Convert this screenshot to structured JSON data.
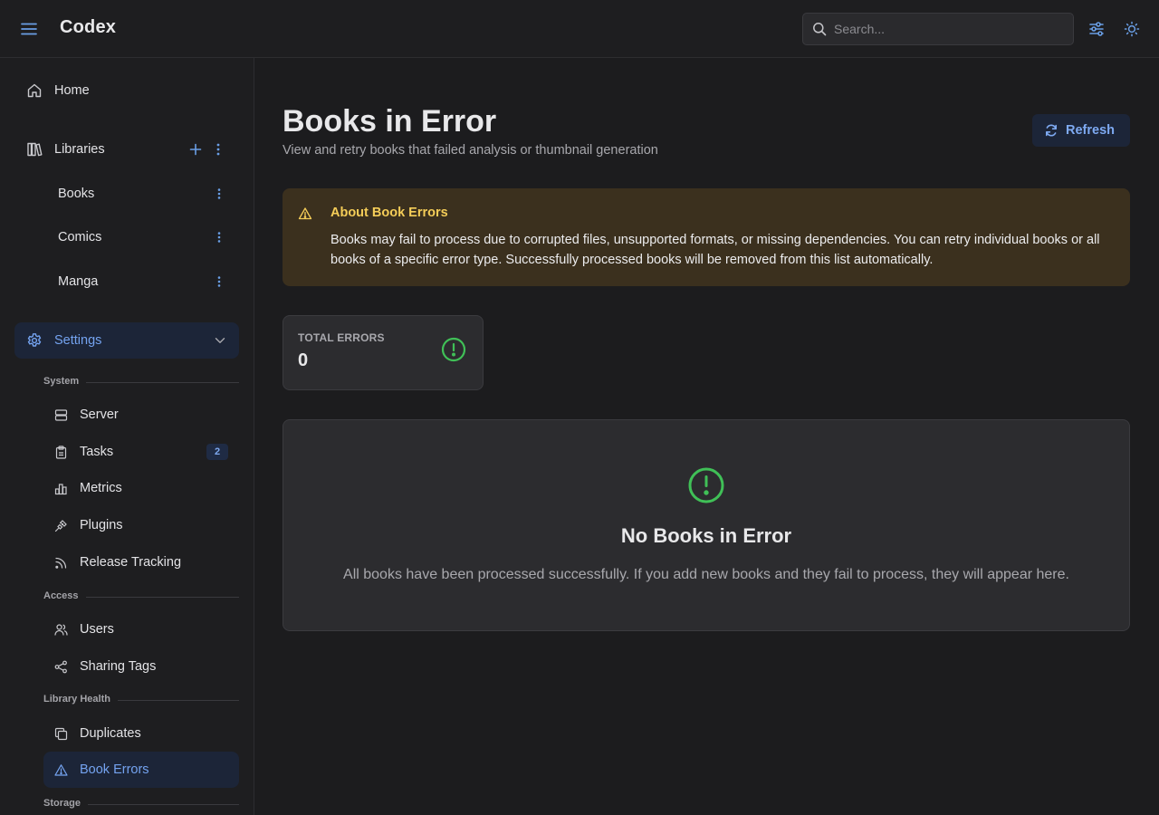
{
  "header": {
    "app_title": "Codex",
    "menu_icon": "hamburger-menu-icon",
    "search_placeholder": "Search...",
    "search_value": "",
    "filters_icon": "sliders-icon",
    "theme_icon": "sun-icon"
  },
  "sidebar": {
    "home": {
      "label": "Home",
      "icon": "home-icon"
    },
    "libraries": {
      "label": "Libraries",
      "icon": "library-icon",
      "items": [
        {
          "label": "Books"
        },
        {
          "label": "Comics"
        },
        {
          "label": "Manga"
        }
      ]
    },
    "settings": {
      "label": "Settings",
      "icon": "gear-icon",
      "expanded": true,
      "sections": [
        {
          "title": "System",
          "items": [
            {
              "label": "Server",
              "icon": "server-icon"
            },
            {
              "label": "Tasks",
              "icon": "clipboard-icon",
              "badge": "2"
            },
            {
              "label": "Metrics",
              "icon": "bar-chart-icon"
            },
            {
              "label": "Plugins",
              "icon": "plug-icon"
            },
            {
              "label": "Release Tracking",
              "icon": "rss-icon"
            }
          ]
        },
        {
          "title": "Access",
          "items": [
            {
              "label": "Users",
              "icon": "users-icon"
            },
            {
              "label": "Sharing Tags",
              "icon": "share-icon"
            }
          ]
        },
        {
          "title": "Library Health",
          "items": [
            {
              "label": "Duplicates",
              "icon": "copy-icon"
            },
            {
              "label": "Book Errors",
              "icon": "warning-triangle-icon",
              "active": true
            }
          ]
        },
        {
          "title": "Storage",
          "items": []
        }
      ]
    }
  },
  "main": {
    "title": "Books in Error",
    "subtitle": "View and retry books that failed analysis or thumbnail generation",
    "refresh_label": "Refresh",
    "alert": {
      "title": "About Book Errors",
      "body": "Books may fail to process due to corrupted files, unsupported formats, or missing dependencies. You can retry individual books or all books of a specific error type. Successfully processed books will be removed from this list automatically."
    },
    "stat": {
      "label": "TOTAL ERRORS",
      "value": "0"
    },
    "empty": {
      "title": "No Books in Error",
      "message": "All books have been processed successfully. If you add new books and they fail to process, they will appear here."
    }
  },
  "colors": {
    "accent": "#74a3f0",
    "success": "#40c057",
    "warning": "#f5cd58",
    "background": "#1c1c1e"
  }
}
